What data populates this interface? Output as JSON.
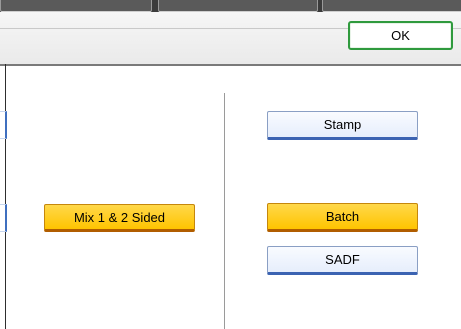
{
  "header": {
    "ok_label": "OK"
  },
  "left_panel": {
    "mix_button_label": "Mix 1 & 2 Sided"
  },
  "right_panel": {
    "stamp_label": "Stamp",
    "batch_label": "Batch",
    "sadf_label": "SADF"
  },
  "colors": {
    "selected_fill": "#ffc400",
    "normal_fill": "#e6eefc",
    "normal_border": "#3b63b2",
    "ok_border": "#2f9a3d"
  },
  "state": {
    "selected_buttons": [
      "Mix 1 & 2 Sided",
      "Batch"
    ]
  }
}
